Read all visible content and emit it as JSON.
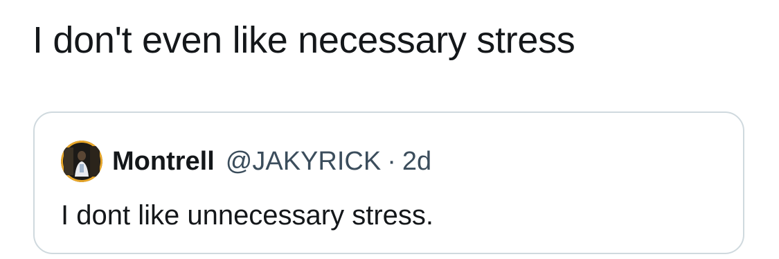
{
  "tweet": {
    "text": "I don't even like necessary stress"
  },
  "quoted_tweet": {
    "author": {
      "display_name": "Montrell",
      "handle": "@JAKYRICK",
      "avatar_icon": "profile-photo-avatar"
    },
    "separator": "·",
    "timestamp": "2d",
    "text": "I dont like unnecessary stress."
  },
  "colors": {
    "text_primary": "#14171a",
    "text_secondary": "#3b4d5c",
    "card_border": "#cfd9de",
    "avatar_ring": "#e8a72a"
  }
}
